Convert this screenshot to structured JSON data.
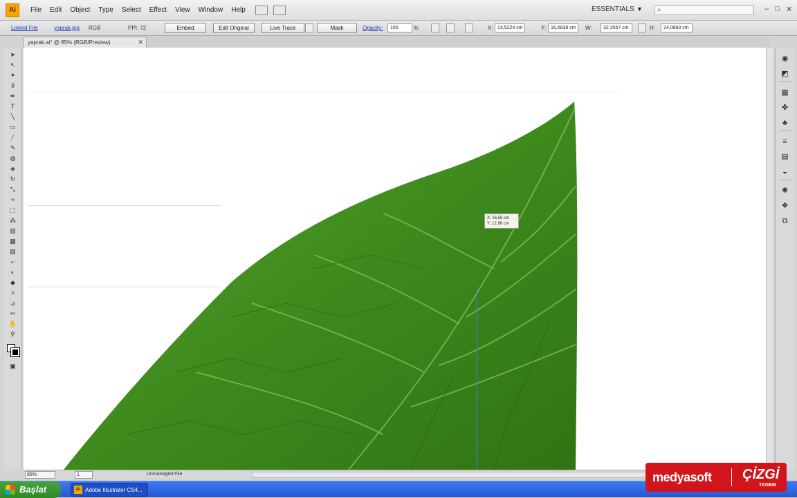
{
  "app": {
    "logo": "Ai",
    "workspace": "ESSENTIALS"
  },
  "menu": [
    "File",
    "Edit",
    "Object",
    "Type",
    "Select",
    "Effect",
    "View",
    "Window",
    "Help"
  ],
  "control": {
    "linked_file": "Linked File",
    "file_name": "yaprak.jpg",
    "color_mode": "RGB",
    "ppi": "PPI: 72",
    "embed_btn": "Embed",
    "edit_original_btn": "Edit Original",
    "live_trace_btn": "Live Trace",
    "mask_btn": "Mask",
    "opacity_label": "Opacity:",
    "opacity_value": "100",
    "opacity_unit": "%",
    "x_label": "X:",
    "x_value": "13,5224 cm",
    "y_label": "Y:",
    "y_value": "16,6839 cm",
    "w_label": "W:",
    "w_value": "32,3557 cm",
    "h_label": "H:",
    "h_value": "24,0893 cm"
  },
  "document": {
    "tab_title": "yaprak.ai* @ 85% (RGB/Preview)"
  },
  "canvas": {
    "tooltip_line1": "X: 26,58 cm",
    "tooltip_line2": "Y: 12,96 cm"
  },
  "status": {
    "zoom": "85%",
    "page": "1",
    "info": "Unmanaged File"
  },
  "taskbar": {
    "start": "Başlat",
    "task_label": "Adobe Illustrator CS4..."
  },
  "watermark": {
    "brand": "medyasoft",
    "logo": "ÇİZGİ",
    "sub": "TAGEM"
  },
  "colors": {
    "leaf": "#3f8a1f",
    "brand_red": "#d2141b",
    "taskbar": "#2458d6"
  },
  "icons": {
    "tools": [
      "selection-icon",
      "direct-selection-icon",
      "magic-wand-icon",
      "lasso-icon",
      "pen-icon",
      "type-icon",
      "line-icon",
      "rectangle-icon",
      "paintbrush-icon",
      "pencil-icon",
      "blob-brush-icon",
      "eraser-icon",
      "rotate-icon",
      "scale-icon",
      "warp-icon",
      "free-transform-icon",
      "symbol-sprayer-icon",
      "graph-icon",
      "mesh-icon",
      "gradient-icon",
      "eyedropper-icon",
      "blend-icon",
      "live-paint-icon",
      "crop-icon",
      "slice-icon",
      "scissors-icon",
      "hand-icon",
      "zoom-icon"
    ],
    "panels": [
      "color-icon",
      "color-guide-icon",
      "swatches-icon",
      "brushes-icon",
      "symbols-icon",
      "stroke-icon",
      "gradient-icon",
      "transparency-icon",
      "appearance-icon",
      "graphic-styles-icon",
      "layers-icon"
    ]
  }
}
